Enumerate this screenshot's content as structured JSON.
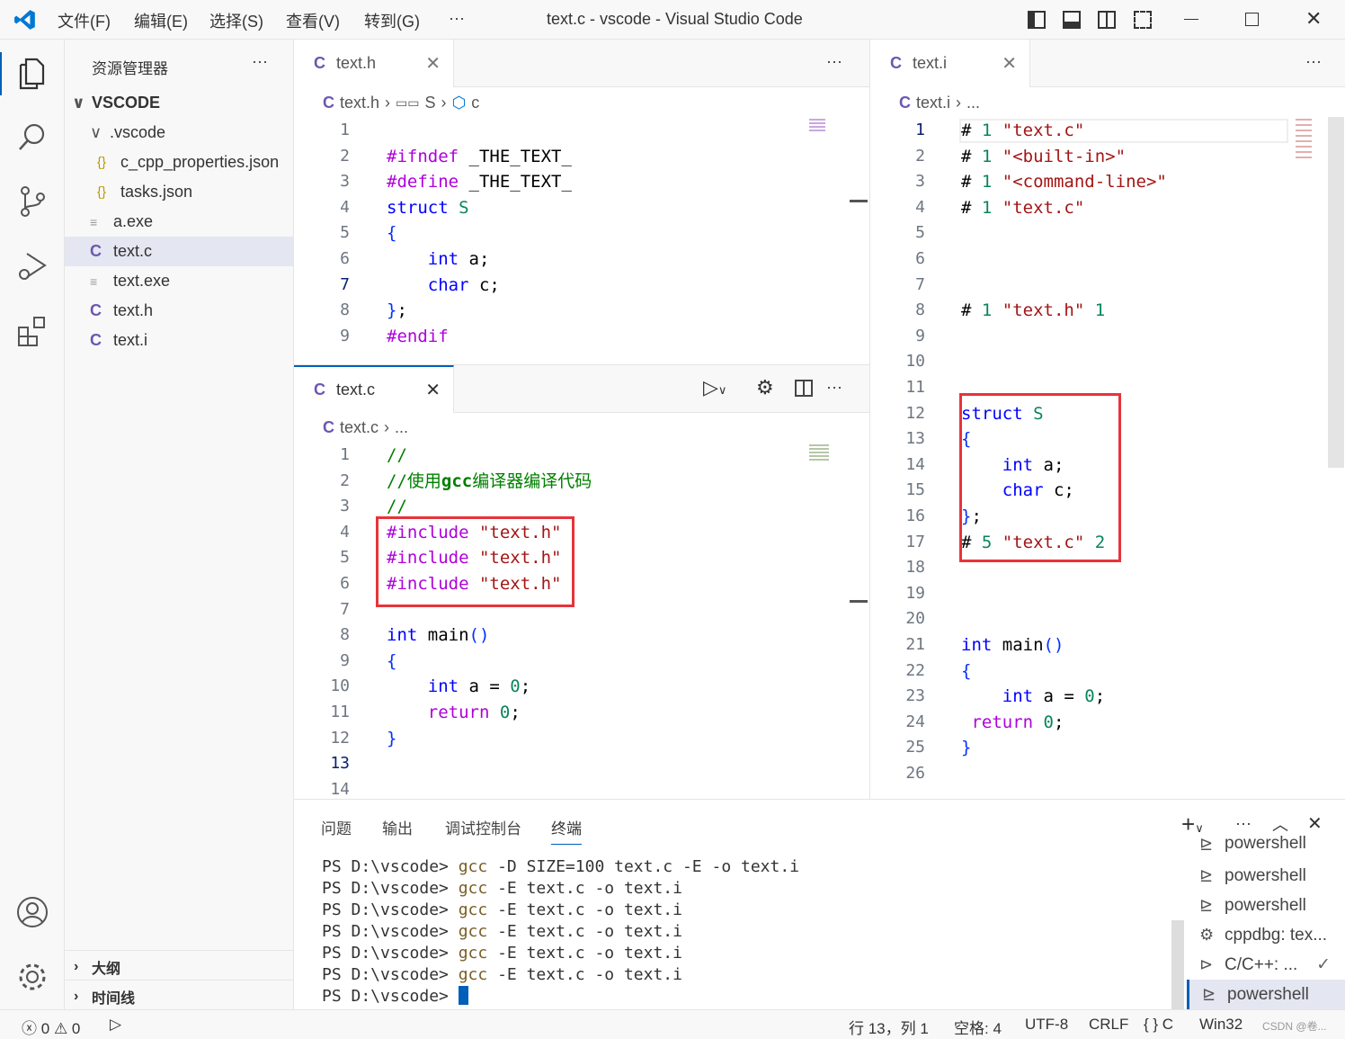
{
  "title": "text.c - vscode - Visual Studio Code",
  "menu": [
    "文件(F)",
    "编辑(E)",
    "选择(S)",
    "查看(V)",
    "转到(G)",
    "···"
  ],
  "sidebar": {
    "title": "资源管理器",
    "more": "···",
    "root": "VSCODE",
    "items": [
      {
        "label": ".vscode",
        "type": "folder"
      },
      {
        "label": "c_cpp_properties.json",
        "type": "json"
      },
      {
        "label": "tasks.json",
        "type": "json"
      },
      {
        "label": "a.exe",
        "type": "exe"
      },
      {
        "label": "text.c",
        "type": "c",
        "selected": true
      },
      {
        "label": "text.exe",
        "type": "exe"
      },
      {
        "label": "text.h",
        "type": "c"
      },
      {
        "label": "text.i",
        "type": "c"
      }
    ],
    "outline": "大纲",
    "timeline": "时间线"
  },
  "icons": {
    "c": "C",
    "json": "{}",
    "exe": "≡"
  },
  "editors": {
    "top": {
      "tab": "text.h",
      "crumb": [
        "text.h",
        "S",
        "c"
      ],
      "active_line": 7,
      "lines": [
        [],
        [
          [
            "p",
            "#ifndef"
          ],
          [
            "d",
            " _THE_TEXT_"
          ]
        ],
        [
          [
            "p",
            "#define"
          ],
          [
            "d",
            " _THE_TEXT_"
          ]
        ],
        [
          [
            "k",
            "struct"
          ],
          [
            "d",
            " "
          ],
          [
            "n",
            "S"
          ]
        ],
        [
          [
            "b",
            "{"
          ]
        ],
        [
          [
            "d",
            "    "
          ],
          [
            "k",
            "int"
          ],
          [
            "d",
            " a;"
          ]
        ],
        [
          [
            "d",
            "    "
          ],
          [
            "k",
            "char"
          ],
          [
            "d",
            " c;"
          ]
        ],
        [
          [
            "b",
            "}"
          ],
          [
            "d",
            ";"
          ]
        ],
        [
          [
            "p",
            "#endif"
          ]
        ]
      ]
    },
    "bottom": {
      "tab": "text.c",
      "crumb": [
        "text.c",
        "..."
      ],
      "active_line": 13,
      "lines": [
        [
          [
            "c",
            "//"
          ]
        ],
        [
          [
            "c",
            "//使用"
          ],
          [
            "cb",
            "gcc"
          ],
          [
            "c",
            "编译器编译代码"
          ]
        ],
        [
          [
            "c",
            "//"
          ]
        ],
        [
          [
            "p",
            "#include"
          ],
          [
            "d",
            " "
          ],
          [
            "s",
            "\"text.h\""
          ]
        ],
        [
          [
            "p",
            "#include"
          ],
          [
            "d",
            " "
          ],
          [
            "s",
            "\"text.h\""
          ]
        ],
        [
          [
            "p",
            "#include"
          ],
          [
            "d",
            " "
          ],
          [
            "s",
            "\"text.h\""
          ]
        ],
        [],
        [
          [
            "k",
            "int"
          ],
          [
            "d",
            " main"
          ],
          [
            "b",
            "()"
          ]
        ],
        [
          [
            "b",
            "{"
          ]
        ],
        [
          [
            "d",
            "    "
          ],
          [
            "k",
            "int"
          ],
          [
            "d",
            " a = "
          ],
          [
            "n",
            "0"
          ],
          [
            "d",
            ";"
          ]
        ],
        [
          [
            "d",
            "    "
          ],
          [
            "p",
            "return"
          ],
          [
            "d",
            " "
          ],
          [
            "n",
            "0"
          ],
          [
            "d",
            ";"
          ]
        ],
        [
          [
            "b",
            "}"
          ]
        ],
        [],
        []
      ]
    },
    "right": {
      "tab": "text.i",
      "crumb": [
        "text.i",
        "..."
      ],
      "active_line": 1,
      "lines": [
        [
          [
            "d",
            "# "
          ],
          [
            "n",
            "1"
          ],
          [
            "d",
            " "
          ],
          [
            "s",
            "\"text.c\""
          ]
        ],
        [
          [
            "d",
            "# "
          ],
          [
            "n",
            "1"
          ],
          [
            "d",
            " "
          ],
          [
            "s",
            "\"<built-in>\""
          ]
        ],
        [
          [
            "d",
            "# "
          ],
          [
            "n",
            "1"
          ],
          [
            "d",
            " "
          ],
          [
            "s",
            "\"<command-line>\""
          ]
        ],
        [
          [
            "d",
            "# "
          ],
          [
            "n",
            "1"
          ],
          [
            "d",
            " "
          ],
          [
            "s",
            "\"text.c\""
          ]
        ],
        [],
        [],
        [],
        [
          [
            "d",
            "# "
          ],
          [
            "n",
            "1"
          ],
          [
            "d",
            " "
          ],
          [
            "s",
            "\"text.h\""
          ],
          [
            "d",
            " "
          ],
          [
            "n",
            "1"
          ]
        ],
        [],
        [],
        [],
        [
          [
            "k",
            "struct"
          ],
          [
            "d",
            " "
          ],
          [
            "n",
            "S"
          ]
        ],
        [
          [
            "b",
            "{"
          ]
        ],
        [
          [
            "d",
            "    "
          ],
          [
            "k",
            "int"
          ],
          [
            "d",
            " a;"
          ]
        ],
        [
          [
            "d",
            "    "
          ],
          [
            "k",
            "char"
          ],
          [
            "d",
            " c;"
          ]
        ],
        [
          [
            "b",
            "}"
          ],
          [
            "d",
            ";"
          ]
        ],
        [
          [
            "d",
            "# "
          ],
          [
            "n",
            "5"
          ],
          [
            "d",
            " "
          ],
          [
            "s",
            "\"text.c\""
          ],
          [
            "d",
            " "
          ],
          [
            "n",
            "2"
          ]
        ],
        [],
        [],
        [],
        [
          [
            "k",
            "int"
          ],
          [
            "d",
            " main"
          ],
          [
            "b",
            "()"
          ]
        ],
        [
          [
            "b",
            "{"
          ]
        ],
        [
          [
            "d",
            "    "
          ],
          [
            "k",
            "int"
          ],
          [
            "d",
            " a = "
          ],
          [
            "n",
            "0"
          ],
          [
            "d",
            ";"
          ]
        ],
        [
          [
            "d",
            " "
          ],
          [
            "p",
            "return"
          ],
          [
            "d",
            " "
          ],
          [
            "n",
            "0"
          ],
          [
            "d",
            ";"
          ]
        ],
        [
          [
            "b",
            "}"
          ]
        ],
        []
      ]
    }
  },
  "panel": {
    "tabs": [
      "问题",
      "输出",
      "调试控制台",
      "终端"
    ],
    "active_tab": 3,
    "terminal": [
      [
        [
          "d",
          "PS D:\\vscode> "
        ],
        [
          "g",
          "gcc"
        ],
        [
          "d",
          " -D SIZE=100 text.c -E -o text.i"
        ]
      ],
      [
        [
          "d",
          "PS D:\\vscode> "
        ],
        [
          "g",
          "gcc"
        ],
        [
          "d",
          " -E text.c -o text.i"
        ]
      ],
      [
        [
          "d",
          "PS D:\\vscode> "
        ],
        [
          "g",
          "gcc"
        ],
        [
          "d",
          " -E text.c -o text.i"
        ]
      ],
      [
        [
          "d",
          "PS D:\\vscode> "
        ],
        [
          "g",
          "gcc"
        ],
        [
          "d",
          " -E text.c -o text.i"
        ]
      ],
      [
        [
          "d",
          "PS D:\\vscode> "
        ],
        [
          "g",
          "gcc"
        ],
        [
          "d",
          " -E text.c -o text.i"
        ]
      ],
      [
        [
          "d",
          "PS D:\\vscode> "
        ],
        [
          "g",
          "gcc"
        ],
        [
          "d",
          " -E text.c -o text.i"
        ]
      ],
      [
        [
          "d",
          "PS D:\\vscode> "
        ]
      ]
    ],
    "terminals": [
      {
        "label": "powershell",
        "icon": "terminal"
      },
      {
        "label": "powershell",
        "icon": "terminal"
      },
      {
        "label": "powershell",
        "icon": "terminal"
      },
      {
        "label": "cppdbg: tex...",
        "icon": "debug"
      },
      {
        "label": "C/C++: ...",
        "icon": "task",
        "check": "✓"
      },
      {
        "label": "powershell",
        "icon": "terminal",
        "selected": true
      }
    ]
  },
  "status": {
    "errors": "0",
    "warnings": "0",
    "position": "行 13，列 1",
    "spaces": "空格: 4",
    "encoding": "UTF-8",
    "eol": "CRLF",
    "language": "{ } C",
    "platform": "Win32",
    "watermark": "CSDN @卷..."
  },
  "colors": {
    "accent": "#005fb8",
    "highlight_box": "#e8333a",
    "keyword": "#0000ff",
    "preprocessor": "#af00db",
    "string": "#a31515",
    "number": "#098658",
    "comment": "#008000"
  }
}
